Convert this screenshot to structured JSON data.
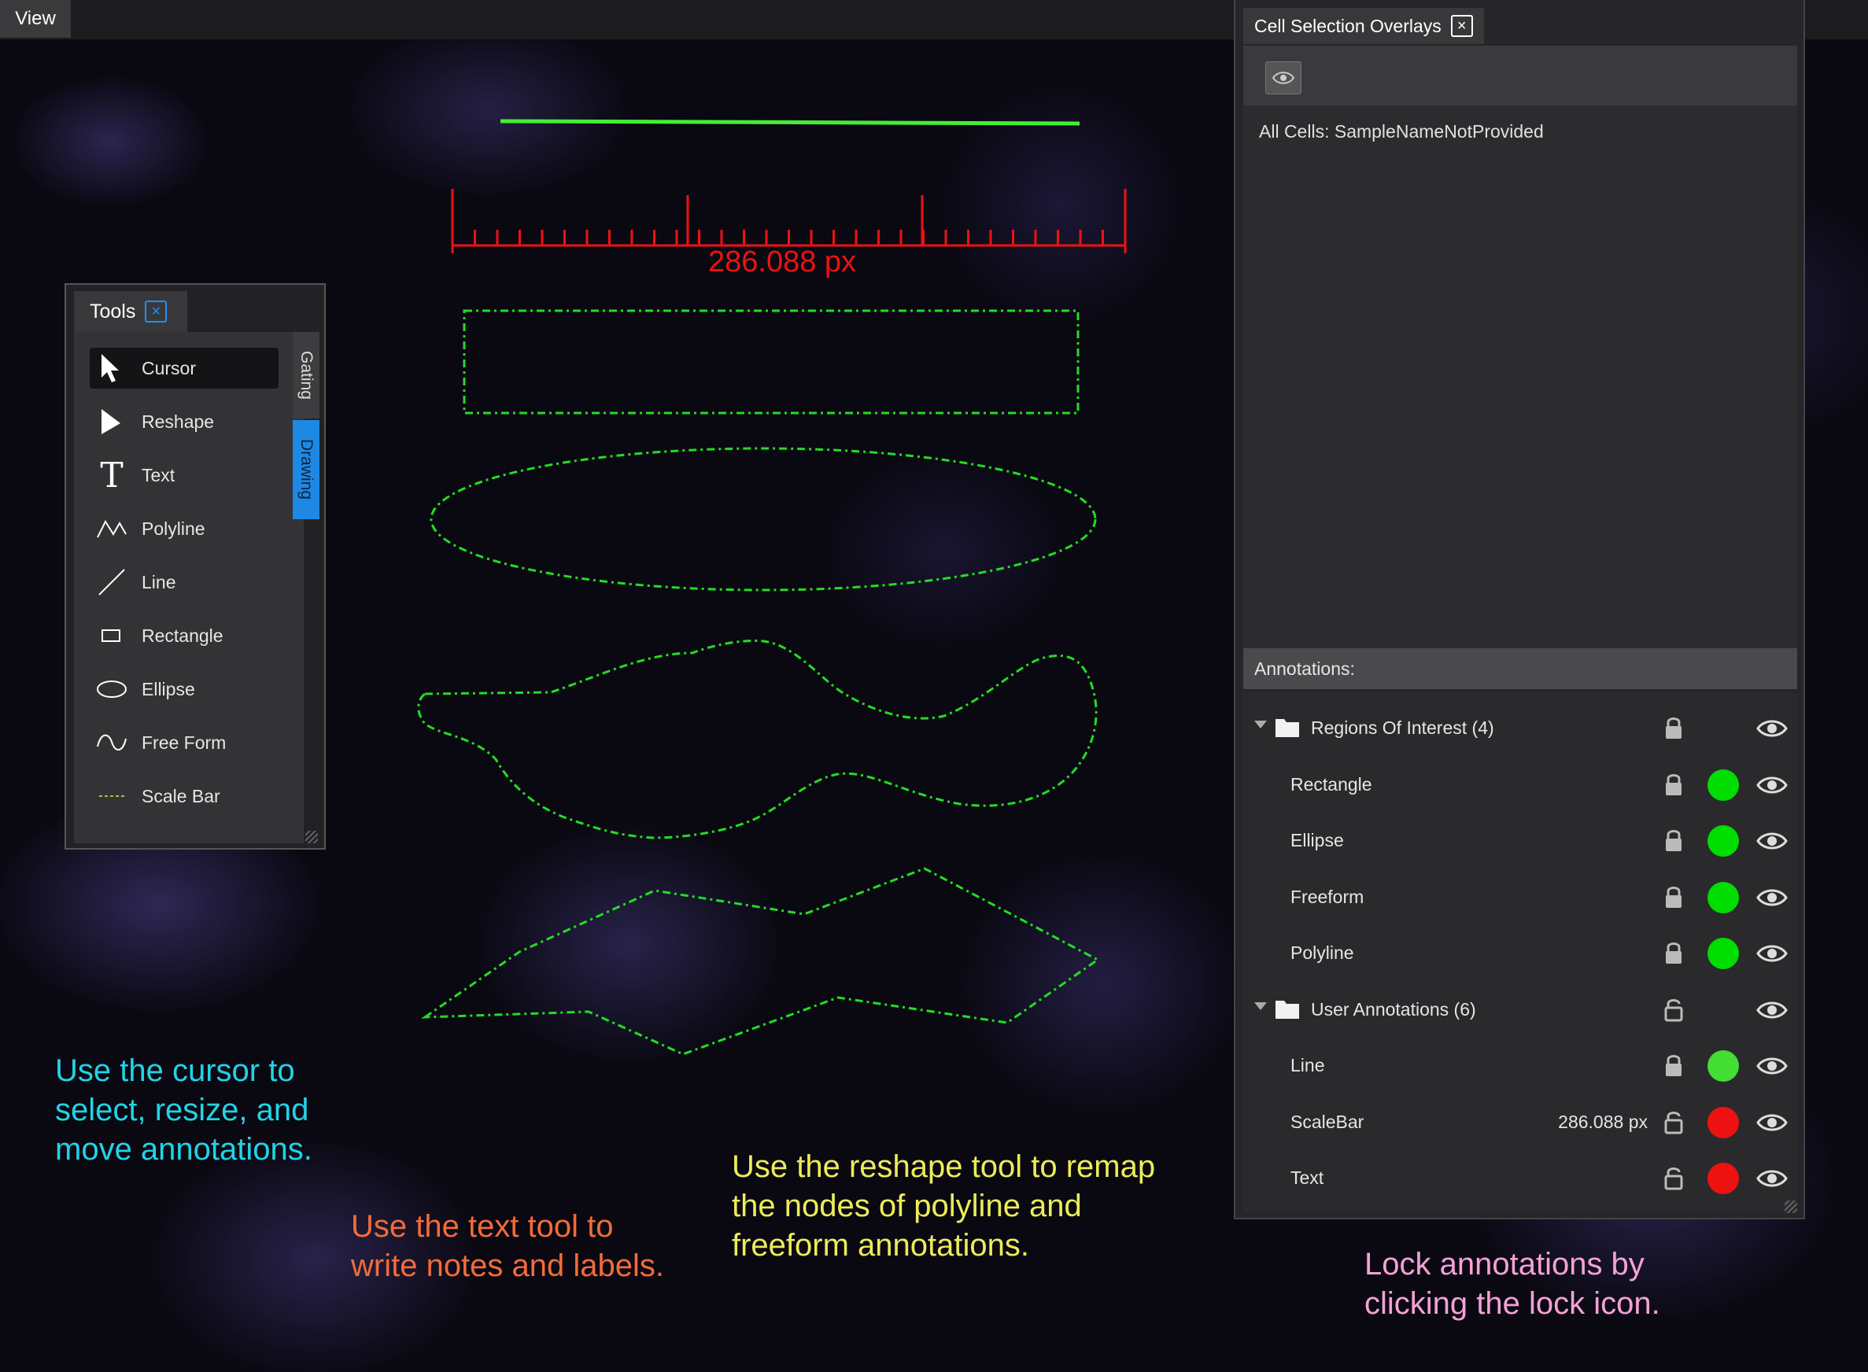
{
  "menu": {
    "view_label": "View"
  },
  "tools_panel": {
    "tab_label": "Tools",
    "close_glyph": "×",
    "items": [
      {
        "label": "Cursor",
        "icon": "cursor-arrow-icon",
        "active": true
      },
      {
        "label": "Reshape",
        "icon": "reshape-arrow-icon",
        "active": false
      },
      {
        "label": "Text",
        "icon": "text-t-icon",
        "active": false
      },
      {
        "label": "Polyline",
        "icon": "polyline-icon",
        "active": false
      },
      {
        "label": "Line",
        "icon": "line-icon",
        "active": false
      },
      {
        "label": "Rectangle",
        "icon": "rectangle-icon",
        "active": false
      },
      {
        "label": "Ellipse",
        "icon": "ellipse-icon",
        "active": false
      },
      {
        "label": "Free Form",
        "icon": "freeform-icon",
        "active": false
      },
      {
        "label": "Scale Bar",
        "icon": "scalebar-icon",
        "active": false
      }
    ],
    "side_tabs": {
      "gating": "Gating",
      "drawing": "Drawing",
      "active": "Drawing"
    }
  },
  "canvas": {
    "scale_bar_label": "286.088 px",
    "colors": {
      "scale_bar": "#ee1111",
      "annotation_green": "#22dd22",
      "line_green": "#44ee33"
    }
  },
  "overlays_panel": {
    "tab_label": "Cell Selection Overlays",
    "close_glyph": "×",
    "all_cells": "All Cells: SampleNameNotProvided",
    "annotations_header": "Annotations:",
    "rows": [
      {
        "kind": "group",
        "label": "Regions Of Interest (4)",
        "locked": true,
        "visible": true
      },
      {
        "kind": "item",
        "label": "Rectangle",
        "locked": true,
        "color": "#00dd00",
        "visible": true
      },
      {
        "kind": "item",
        "label": "Ellipse",
        "locked": true,
        "color": "#00dd00",
        "visible": true
      },
      {
        "kind": "item",
        "label": "Freeform",
        "locked": true,
        "color": "#00dd00",
        "visible": true
      },
      {
        "kind": "item",
        "label": "Polyline",
        "locked": true,
        "color": "#00dd00",
        "visible": true
      },
      {
        "kind": "group",
        "label": "User Annotations (6)",
        "locked": false,
        "visible": true
      },
      {
        "kind": "item",
        "label": "Line",
        "locked": true,
        "color": "#44dd33",
        "visible": true
      },
      {
        "kind": "item",
        "label": "ScaleBar",
        "value": "286.088 px",
        "locked": false,
        "color": "#ee1111",
        "visible": true
      },
      {
        "kind": "item",
        "label": "Text",
        "locked": false,
        "color": "#ee1111",
        "visible": true
      }
    ]
  },
  "callouts": {
    "cursor": [
      "Use the cursor to",
      "select, resize, and",
      "move annotations."
    ],
    "text": [
      "Use the text tool to",
      "write notes and labels."
    ],
    "reshape": [
      "Use the reshape tool to remap",
      "the nodes of polyline and",
      "freeform annotations."
    ],
    "lock": [
      "Lock annotations by",
      "clicking the lock icon."
    ]
  }
}
